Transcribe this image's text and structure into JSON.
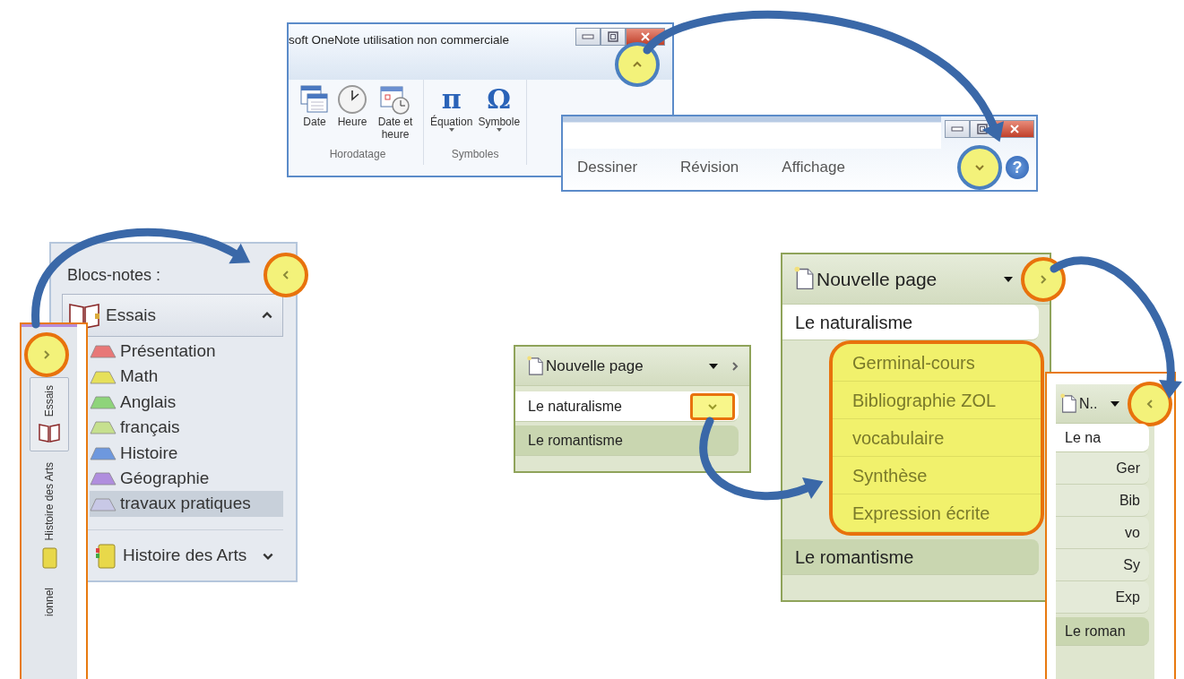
{
  "ribbon_expanded": {
    "title": "soft OneNote utilisation non commerciale",
    "groups": [
      {
        "label": "Horodatage",
        "commands": [
          {
            "label": "Date",
            "kind": "calendar",
            "dropdown": false
          },
          {
            "label": "Heure",
            "kind": "clock",
            "dropdown": false
          },
          {
            "label": "Date et heure",
            "kind": "calendar-clock",
            "dropdown": false
          }
        ]
      },
      {
        "label": "Symboles",
        "commands": [
          {
            "label": "Équation",
            "kind": "glyph",
            "glyph": "π",
            "dropdown": true
          },
          {
            "label": "Symbole",
            "kind": "glyph",
            "glyph": "Ω",
            "dropdown": true
          }
        ]
      }
    ],
    "collapse_button": {
      "highlighted": true
    }
  },
  "ribbon_collapsed": {
    "tabs": [
      "Dessiner",
      "Révision",
      "Affichage"
    ],
    "expand_button": {
      "highlighted": true
    },
    "help_button": "?"
  },
  "notebook_pane": {
    "header": "Blocs-notes :",
    "toggle": {
      "highlighted": true
    },
    "notebooks": [
      {
        "name": "Essais",
        "expanded": true,
        "sections": [
          {
            "name": "Présentation",
            "color": "#e87878",
            "selected": false
          },
          {
            "name": "Math",
            "color": "#e6e05a",
            "selected": false
          },
          {
            "name": "Anglais",
            "color": "#8ed47a",
            "selected": false
          },
          {
            "name": "français",
            "color": "#c6e08e",
            "selected": false
          },
          {
            "name": "Histoire",
            "color": "#6e98de",
            "selected": false
          },
          {
            "name": "Géographie",
            "color": "#b08ede",
            "selected": false
          },
          {
            "name": "travaux pratiques",
            "color": "#c8c8e6",
            "selected": true
          }
        ]
      },
      {
        "name": "Histoire des Arts",
        "expanded": false
      }
    ]
  },
  "notebook_pane_collapsed": {
    "toggle": {
      "highlighted": true
    },
    "tabs": [
      {
        "label": "Essais",
        "selected": true
      },
      {
        "label": "Histoire des Arts",
        "selected": false
      },
      {
        "label": "ionnel",
        "selected": false
      }
    ]
  },
  "page_lists": [
    {
      "header": "Nouvelle page",
      "toggle": {
        "highlighted": false
      },
      "pages": [
        {
          "title": "Le naturalisme",
          "selected": true,
          "expand_button": {
            "highlighted": true
          }
        },
        {
          "title": "Le romantisme",
          "selected": false
        }
      ]
    },
    {
      "header": "Nouvelle page",
      "toggle": {
        "highlighted": true
      },
      "pages": [
        {
          "title": "Le naturalisme",
          "selected": true,
          "subpages_highlighted": true,
          "subpages": [
            "Germinal-cours",
            "Bibliographie ZOL",
            "vocabulaire",
            "Synthèse",
            "Expression écrite"
          ]
        },
        {
          "title": "Le romantisme",
          "selected": false
        }
      ]
    },
    {
      "header": "N..",
      "toggle": {
        "highlighted": true
      },
      "pages": [
        {
          "title": "Le na",
          "selected": true,
          "subpages": [
            "Ger",
            "Bib",
            "vo",
            "Sy",
            "Exp"
          ]
        },
        {
          "title": "Le roman",
          "selected": false
        }
      ]
    }
  ]
}
